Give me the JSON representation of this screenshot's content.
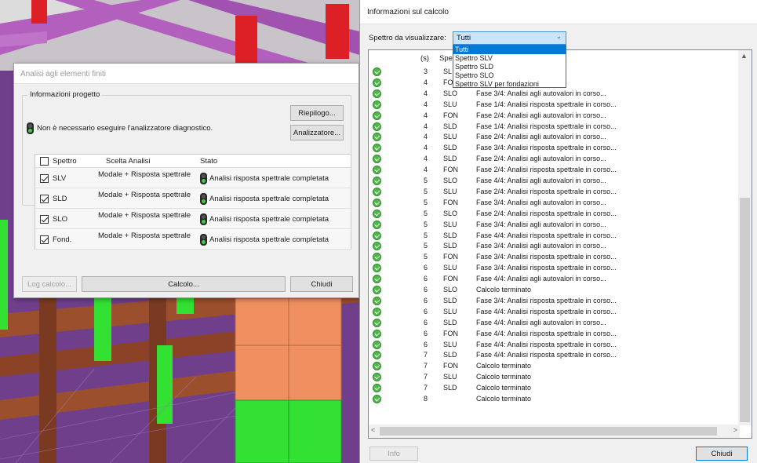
{
  "fem_dialog": {
    "title": "Analisi agli elementi finiti",
    "project_group": "Informazioni progetto",
    "diagnostic_text": "Non è necessario eseguire l'analizzatore diagnostico.",
    "summary_button": "Riepilogo...",
    "analyzer_button": "Analizzatore...",
    "table": {
      "headers": [
        "Spettro",
        "Scelta Analisi",
        "Stato"
      ],
      "rows": [
        {
          "spectrum": "SLV",
          "analysis": "Modale + Risposta spettrale",
          "status": "Analisi risposta spettrale completata",
          "checked": true
        },
        {
          "spectrum": "SLD",
          "analysis": "Modale + Risposta spettrale",
          "status": "Analisi risposta spettrale completata",
          "checked": true
        },
        {
          "spectrum": "SLO",
          "analysis": "Modale + Risposta spettrale",
          "status": "Analisi risposta spettrale completata",
          "checked": true
        },
        {
          "spectrum": "Fond.",
          "analysis": "Modale + Risposta spettrale",
          "status": "Analisi risposta spettrale completata",
          "checked": true
        }
      ]
    },
    "log_button": "Log calcolo...",
    "calc_button": "Calcolo...",
    "close_button": "Chiudi"
  },
  "calc_dialog": {
    "title": "Informazioni sul calcolo",
    "spectrum_label": "Spettro da visualizzare:",
    "spectrum_value": "Tutti",
    "dropdown_options": [
      "Tutti",
      "Spettro SLV",
      "Spettro SLD",
      "Spettro SLO",
      "Spettro SLV per fondazioni"
    ],
    "list_headers": {
      "s": "(s)",
      "spectrum": "Spe"
    },
    "log_rows": [
      {
        "s": "3",
        "spec": "SL",
        "msg": "ttrale in corso..."
      },
      {
        "s": "4",
        "spec": "FO",
        "msg": "ttrale in corso..."
      },
      {
        "s": "4",
        "spec": "SLO",
        "msg": "Fase 3/4: Analisi agli autovalori in corso..."
      },
      {
        "s": "4",
        "spec": "SLU",
        "msg": "Fase 1/4: Analisi risposta spettrale in corso..."
      },
      {
        "s": "4",
        "spec": "FON",
        "msg": "Fase 2/4: Analisi agli autovalori in corso..."
      },
      {
        "s": "4",
        "spec": "SLD",
        "msg": "Fase 1/4: Analisi risposta spettrale in corso..."
      },
      {
        "s": "4",
        "spec": "SLU",
        "msg": "Fase 2/4: Analisi agli autovalori in corso..."
      },
      {
        "s": "4",
        "spec": "SLD",
        "msg": "Fase 3/4: Analisi risposta spettrale in corso..."
      },
      {
        "s": "4",
        "spec": "SLD",
        "msg": "Fase 2/4: Analisi agli autovalori in corso..."
      },
      {
        "s": "4",
        "spec": "FON",
        "msg": "Fase 2/4: Analisi risposta spettrale in corso..."
      },
      {
        "s": "5",
        "spec": "SLO",
        "msg": "Fase 4/4: Analisi agli autovalori in corso..."
      },
      {
        "s": "5",
        "spec": "SLU",
        "msg": "Fase 2/4: Analisi risposta spettrale in corso..."
      },
      {
        "s": "5",
        "spec": "FON",
        "msg": "Fase 3/4: Analisi agli autovalori in corso..."
      },
      {
        "s": "5",
        "spec": "SLO",
        "msg": "Fase 2/4: Analisi risposta spettrale in corso..."
      },
      {
        "s": "5",
        "spec": "SLU",
        "msg": "Fase 3/4: Analisi agli autovalori in corso..."
      },
      {
        "s": "5",
        "spec": "SLD",
        "msg": "Fase 4/4: Analisi risposta spettrale in corso..."
      },
      {
        "s": "5",
        "spec": "SLD",
        "msg": "Fase 3/4: Analisi agli autovalori in corso..."
      },
      {
        "s": "5",
        "spec": "FON",
        "msg": "Fase 3/4: Analisi risposta spettrale in corso..."
      },
      {
        "s": "6",
        "spec": "SLU",
        "msg": "Fase 3/4: Analisi risposta spettrale in corso..."
      },
      {
        "s": "6",
        "spec": "FON",
        "msg": "Fase 4/4: Analisi agli autovalori in corso..."
      },
      {
        "s": "6",
        "spec": "SLO",
        "msg": "Calcolo terminato"
      },
      {
        "s": "6",
        "spec": "SLD",
        "msg": "Fase 3/4: Analisi risposta spettrale in corso..."
      },
      {
        "s": "6",
        "spec": "SLU",
        "msg": "Fase 4/4: Analisi risposta spettrale in corso..."
      },
      {
        "s": "6",
        "spec": "SLD",
        "msg": "Fase 4/4: Analisi agli autovalori in corso..."
      },
      {
        "s": "6",
        "spec": "FON",
        "msg": "Fase 4/4: Analisi risposta spettrale in corso..."
      },
      {
        "s": "6",
        "spec": "SLU",
        "msg": "Fase 4/4: Analisi risposta spettrale in corso..."
      },
      {
        "s": "7",
        "spec": "SLD",
        "msg": "Fase 4/4: Analisi risposta spettrale in corso..."
      },
      {
        "s": "7",
        "spec": "FON",
        "msg": "Calcolo terminato"
      },
      {
        "s": "7",
        "spec": "SLU",
        "msg": "Calcolo terminato"
      },
      {
        "s": "7",
        "spec": "SLD",
        "msg": "Calcolo terminato"
      },
      {
        "s": "8",
        "spec": "",
        "msg": "Calcolo terminato"
      }
    ],
    "info_button": "Info",
    "close_button": "Chiudi"
  },
  "colors": {
    "mesh_purple": "#6e3f8a",
    "beam_brown": "#7a3a22",
    "wall_orange": "#f09060",
    "column_green": "#33e133",
    "accent_blue": "#0078d7",
    "ok_green": "#4fb947"
  }
}
